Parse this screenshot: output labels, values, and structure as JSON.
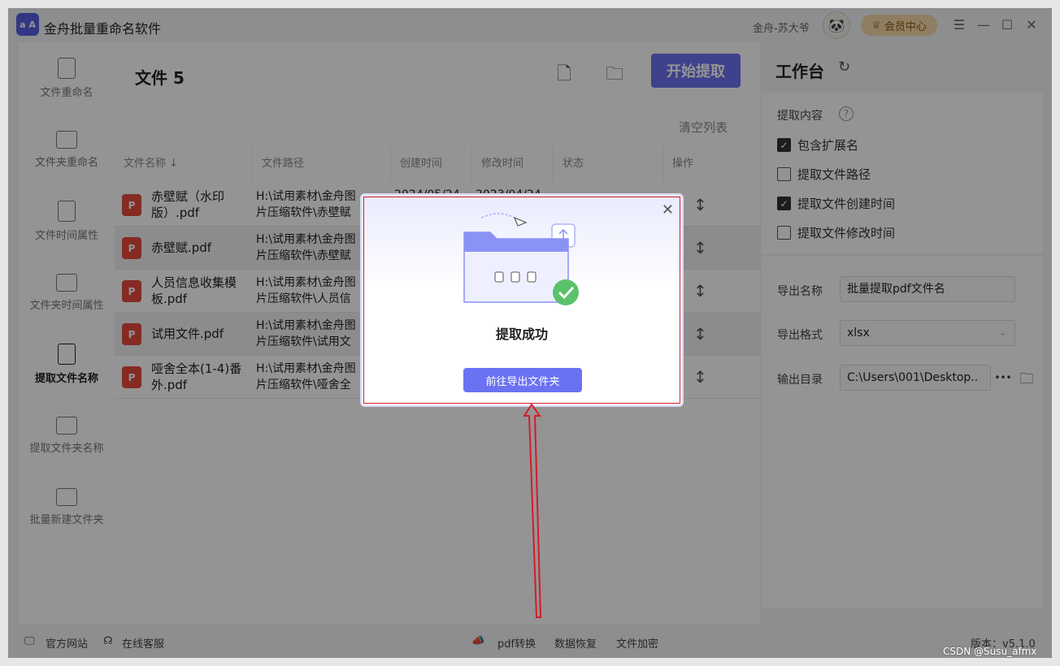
{
  "app": {
    "logo_text": "a A",
    "title": "金舟批量重命名软件",
    "user_name": "金舟-苏大爷",
    "avatar_icon": "panda-avatar",
    "vip_label": "会员中心"
  },
  "sidebar": {
    "items": [
      {
        "label": "文件重命名",
        "icon": "file-rename-icon"
      },
      {
        "label": "文件夹重命名",
        "icon": "folder-rename-icon"
      },
      {
        "label": "文件时间属性",
        "icon": "file-time-icon"
      },
      {
        "label": "文件夹时间属性",
        "icon": "folder-time-icon"
      },
      {
        "label": "提取文件名称",
        "icon": "extract-file-icon",
        "active": true
      },
      {
        "label": "提取文件夹名称",
        "icon": "extract-folder-icon"
      },
      {
        "label": "批量新建文件夹",
        "icon": "new-folder-icon"
      }
    ]
  },
  "main": {
    "title": "文件 5",
    "start_button": "开始提取",
    "clear_list": "清空列表",
    "columns": [
      "文件名称 ↓",
      "文件路径",
      "创建时间",
      "修改时间",
      "状态",
      "操作"
    ],
    "rows": [
      {
        "name": "赤壁赋（水印版）.pdf",
        "path1": "H:\\试用素材\\金舟图",
        "path2": "片压缩软件\\赤壁赋",
        "created": "2024/05/24",
        "modified": "2023/04/24"
      },
      {
        "name": "赤壁赋.pdf",
        "path1": "H:\\试用素材\\金舟图",
        "path2": "片压缩软件\\赤壁赋",
        "created": "",
        "modified": ""
      },
      {
        "name": "人员信息收集模板.pdf",
        "path1": "H:\\试用素材\\金舟图",
        "path2": "片压缩软件\\人员信",
        "created": "",
        "modified": ""
      },
      {
        "name": "试用文件.pdf",
        "path1": "H:\\试用素材\\金舟图",
        "path2": "片压缩软件\\试用文",
        "created": "",
        "modified": ""
      },
      {
        "name": "哑舍全本(1-4)番外.pdf",
        "path1": "H:\\试用素材\\金舟图",
        "path2": "片压缩软件\\哑舍全",
        "created": "",
        "modified": ""
      }
    ]
  },
  "workbench": {
    "title": "工作台",
    "extract_label": "提取内容",
    "options": [
      {
        "label": "包含扩展名",
        "checked": true
      },
      {
        "label": "提取文件路径",
        "checked": false
      },
      {
        "label": "提取文件创建时间",
        "checked": true
      },
      {
        "label": "提取文件修改时间",
        "checked": false
      }
    ],
    "export_name_label": "导出名称",
    "export_name_value": "批量提取pdf文件名",
    "export_format_label": "导出格式",
    "export_format_value": "xlsx",
    "output_dir_label": "输出目录",
    "output_dir_value": "C:\\Users\\001\\Desktop..",
    "more_label": "•••"
  },
  "statusbar": {
    "website": "官方网站",
    "support": "在线客服",
    "pdf": "pdf转换",
    "recover": "数据恢复",
    "encrypt": "文件加密",
    "version": "版本：v5.1.0"
  },
  "dialog": {
    "message": "提取成功",
    "button": "前往导出文件夹"
  },
  "watermark": "CSDN @Susu_afmx",
  "colors": {
    "accent": "#6b72f2",
    "annotation_red": "#d51b2a",
    "success_green": "#5ac26b"
  }
}
